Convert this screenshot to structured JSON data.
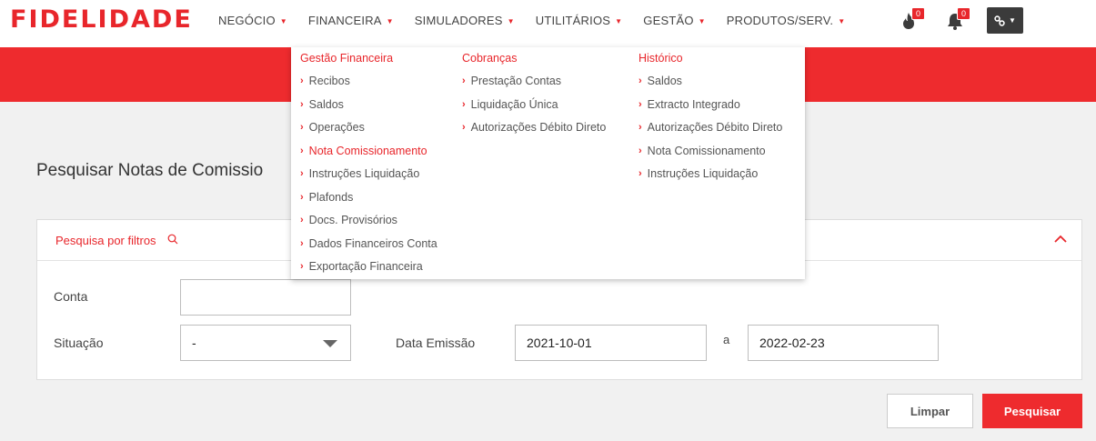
{
  "brand": {
    "logo_text": "FIDELIDADE",
    "accent_color": "#ee2b2e"
  },
  "nav": {
    "items": [
      {
        "label": "NEGÓCIO"
      },
      {
        "label": "FINANCEIRA"
      },
      {
        "label": "SIMULADORES"
      },
      {
        "label": "UTILITÁRIOS"
      },
      {
        "label": "GESTÃO"
      },
      {
        "label": "PRODUTOS/SERV."
      }
    ]
  },
  "icons": {
    "fire_badge": "0",
    "bell_badge": "0",
    "link_icon": "link-icon"
  },
  "menu": {
    "columns": [
      {
        "heading": "Gestão Financeira",
        "items": [
          "Recibos",
          "Saldos",
          "Operações",
          "Nota Comissionamento",
          "Instruções Liquidação",
          "Plafonds",
          "Docs. Provisórios",
          "Dados Financeiros Conta",
          "Exportação Financeira"
        ]
      },
      {
        "heading": "Cobranças",
        "items": [
          "Prestação Contas",
          "Liquidação Única",
          "Autorizações Débito Direto"
        ]
      },
      {
        "heading": "Histórico",
        "items": [
          "Saldos",
          "Extracto Integrado",
          "Autorizações Débito Direto",
          "Nota Comissionamento",
          "Instruções Liquidação"
        ]
      }
    ]
  },
  "page": {
    "title": "Pesquisar Notas de Comissio"
  },
  "filters": {
    "header_label": "Pesquisa por filtros",
    "conta_label": "Conta",
    "conta_value": "",
    "situacao_label": "Situação",
    "situacao_value": "-",
    "data_label": "Data Emissão",
    "date_from": "2021-10-01",
    "range_sep": "a",
    "date_to": "2022-02-23"
  },
  "actions": {
    "clear_label": "Limpar",
    "search_label": "Pesquisar"
  }
}
